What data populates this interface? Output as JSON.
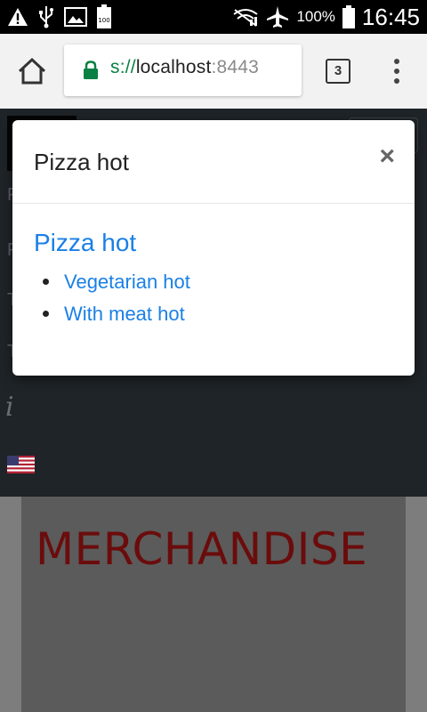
{
  "status_bar": {
    "battery_percent": "100%",
    "time": "16:45",
    "left_icons": [
      "warning-icon",
      "usb-icon",
      "image-icon",
      "battery-saver-icon"
    ],
    "right_icons": [
      "no-signal-icon",
      "airplane-icon",
      "battery-icon"
    ]
  },
  "browser": {
    "url_scheme": "s://",
    "url_host": "localhost",
    "url_port": ":8443",
    "tab_count": "3"
  },
  "page": {
    "merch_title": "MERCHANDISE",
    "colors": {
      "merch_title": "#6b0c0c",
      "link": "#1a80e6"
    }
  },
  "modal": {
    "title": "Pizza hot",
    "close_label": "×",
    "heading": "Pizza hot",
    "items": [
      {
        "label": "Vegetarian hot"
      },
      {
        "label": "With meat hot"
      }
    ]
  }
}
